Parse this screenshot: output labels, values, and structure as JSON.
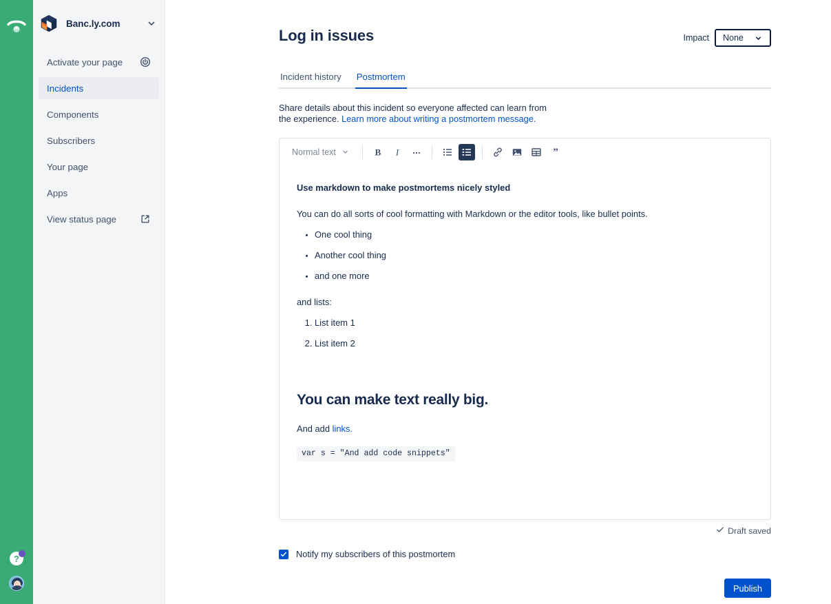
{
  "rail": {
    "brand_icon": "statuspage-signal-icon",
    "green": "#3aab77",
    "help_icon": "question-mark-icon",
    "avatar_icon": "user-avatar"
  },
  "sidebar": {
    "site_name": "Banc.ly.com",
    "site_logo_icon": "statuspage-cube-logo",
    "switch_icon": "chevron-down-icon",
    "items": [
      {
        "label": "Activate your page",
        "icon": "power-icon",
        "active": false
      },
      {
        "label": "Incidents",
        "icon": "",
        "active": true
      },
      {
        "label": "Components",
        "icon": "",
        "active": false
      },
      {
        "label": "Subscribers",
        "icon": "",
        "active": false
      },
      {
        "label": "Your page",
        "icon": "",
        "active": false
      },
      {
        "label": "Apps",
        "icon": "",
        "active": false
      },
      {
        "label": "View status page",
        "icon": "external-link-icon",
        "active": false
      }
    ]
  },
  "header": {
    "title": "Log in issues",
    "impact_label": "Impact",
    "impact_value": "None",
    "impact_options": [
      "None"
    ]
  },
  "tabs": [
    {
      "label": "Incident history",
      "active": false
    },
    {
      "label": "Postmortem",
      "active": true
    }
  ],
  "blurb": {
    "text": "Share details about this incident so everyone affected can learn from the experience. ",
    "link_text": "Learn more about writing a postmortem message."
  },
  "editor": {
    "style_select": "Normal text",
    "tools": [
      {
        "name": "bold-icon",
        "label": "B",
        "active": false
      },
      {
        "name": "italic-icon",
        "label": "I",
        "active": false
      },
      {
        "name": "more-formatting-icon",
        "label": "…",
        "active": false
      },
      {
        "name": "bullet-list-icon",
        "label": "",
        "active": false
      },
      {
        "name": "numbered-list-icon",
        "label": "",
        "active": true
      },
      {
        "name": "link-icon",
        "label": "",
        "active": false
      },
      {
        "name": "image-icon",
        "label": "",
        "active": false
      },
      {
        "name": "table-icon",
        "label": "",
        "active": false
      },
      {
        "name": "quote-icon",
        "label": "",
        "active": false
      }
    ],
    "doc": {
      "heading": "Use markdown to make postmortems nicely styled",
      "intro": "You can do all sorts of cool formatting with Markdown or the editor tools, like bullet points.",
      "bullets": [
        "One cool thing",
        "Another cool thing",
        "and one more"
      ],
      "lists_lead": "and lists:",
      "ordered": [
        "List item 1",
        "List item 2"
      ],
      "big_heading": "You can make text really big.",
      "link_line_prefix": "And add ",
      "link_line_link": "links.",
      "code": "var s = \"And add code snippets\""
    }
  },
  "footer": {
    "draft_status": "Draft saved",
    "draft_icon": "check-icon",
    "notify_label": "Notify my subscribers of this postmortem",
    "notify_checked": true,
    "publish_label": "Publish"
  },
  "colors": {
    "brand_green": "#3aab77",
    "accent_blue": "#0052CC",
    "text": "#172B4D",
    "muted": "#42526E",
    "sidebar_bg": "#F4F5F7",
    "active_toolbar": "#253858"
  }
}
